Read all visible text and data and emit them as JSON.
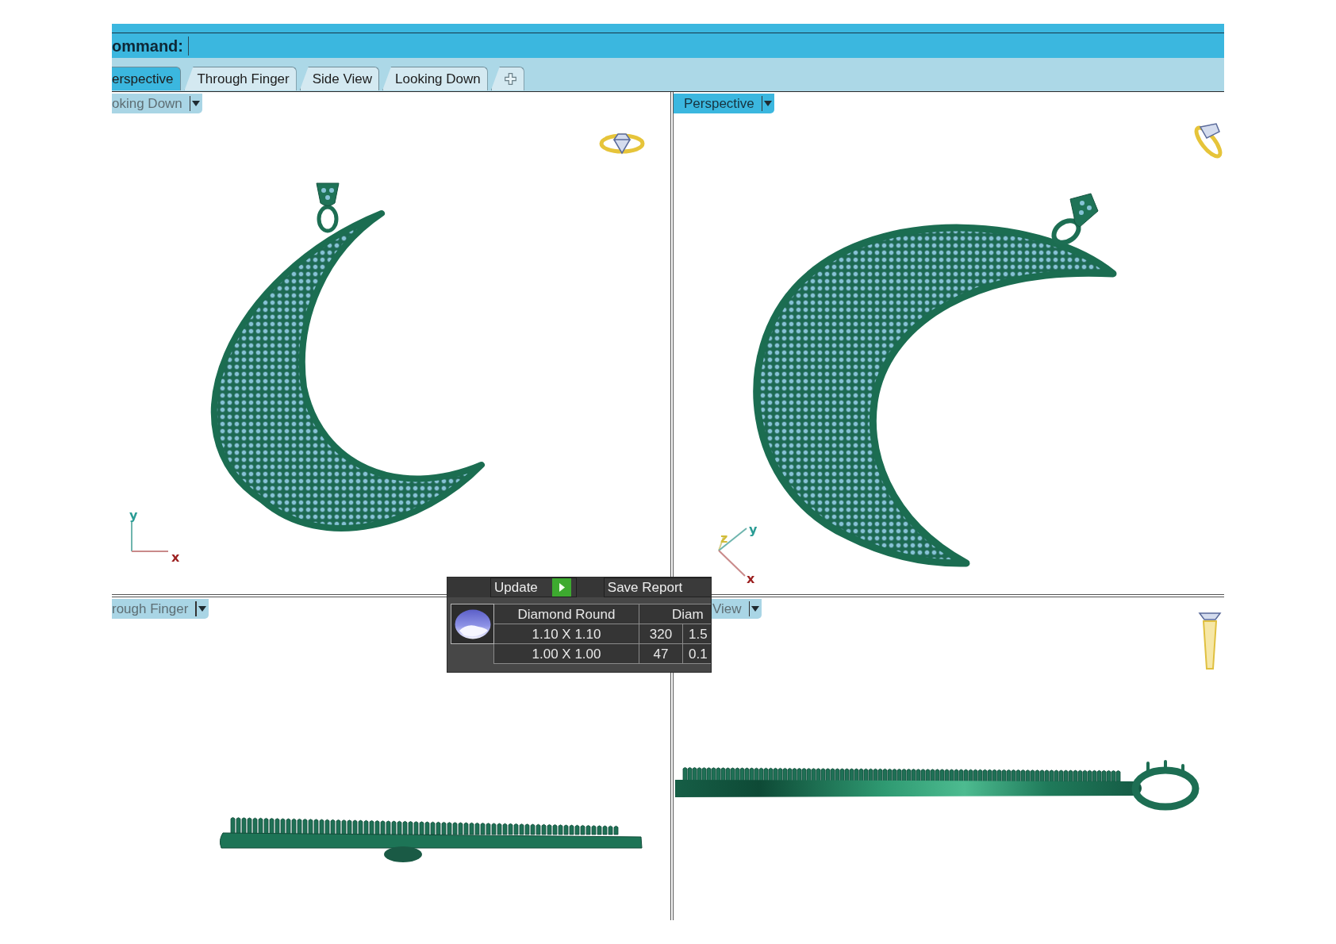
{
  "command_bar": {
    "label": "ommand:"
  },
  "tabs": [
    {
      "label": "erspective",
      "selected": true
    },
    {
      "label": "Through Finger",
      "selected": false
    },
    {
      "label": "Side View",
      "selected": false
    },
    {
      "label": "Looking Down",
      "selected": false
    }
  ],
  "viewports": [
    {
      "kind": "top",
      "label": "oking Down",
      "selected": false,
      "axes": [
        {
          "kind": "y",
          "label": "y"
        },
        {
          "kind": "x",
          "label": "x"
        }
      ]
    },
    {
      "kind": "perspective",
      "label": "Perspective",
      "selected": true,
      "axes": [
        {
          "kind": "z",
          "label": "z"
        },
        {
          "kind": "y",
          "label": "y"
        },
        {
          "kind": "x",
          "label": "x"
        }
      ]
    },
    {
      "kind": "front",
      "label": "rough Finger",
      "selected": false
    },
    {
      "kind": "side",
      "label": "View",
      "selected": false
    }
  ],
  "report_panel": {
    "update_button": "Update",
    "save_button": "Save Report",
    "table": {
      "columns": [
        {
          "label": "Diamond Round"
        },
        {
          "label": "Diam",
          "colspan": 2
        }
      ],
      "rows": [
        [
          "1.10 X 1.10",
          "320",
          "1.5"
        ],
        [
          "1.00 X 1.00",
          "47",
          "0.1"
        ]
      ]
    }
  }
}
